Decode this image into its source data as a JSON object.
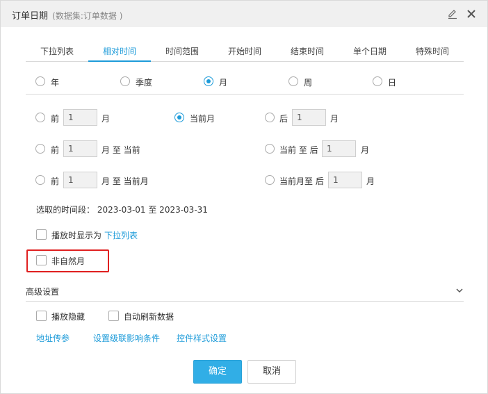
{
  "dialog": {
    "title": "订单日期",
    "dataset": "(数据集:订单数据 )",
    "icons": {
      "edit": "edit-pencil-icon",
      "close": "close-x-icon"
    }
  },
  "tabs": [
    {
      "label": "下拉列表",
      "active": false
    },
    {
      "label": "相对时间",
      "active": true
    },
    {
      "label": "时间范围",
      "active": false
    },
    {
      "label": "开始时间",
      "active": false
    },
    {
      "label": "结束时间",
      "active": false
    },
    {
      "label": "单个日期",
      "active": false
    },
    {
      "label": "特殊时间",
      "active": false
    }
  ],
  "units": [
    {
      "label": "年",
      "checked": false
    },
    {
      "label": "季度",
      "checked": false
    },
    {
      "label": "月",
      "checked": true
    },
    {
      "label": "周",
      "checked": false
    },
    {
      "label": "日",
      "checked": false
    }
  ],
  "options": {
    "row1": {
      "prev_label": "前",
      "prev_value": "1",
      "prev_unit": "月",
      "current_label": "当前月",
      "next_label": "后",
      "next_value": "1",
      "next_unit": "月"
    },
    "row2": {
      "prev_label": "前",
      "prev_value": "1",
      "prev_suffix": "月 至 当前",
      "curnext_label": "当前 至 后",
      "curnext_value": "1",
      "curnext_unit": "月"
    },
    "row3": {
      "prev_label": "前",
      "prev_value": "1",
      "prev_suffix": "月 至 当前月",
      "curnext_label": "当前月至 后",
      "curnext_value": "1",
      "curnext_unit": "月"
    }
  },
  "selected_range": "选取的时间段： 2023-03-01 至 2023-03-31",
  "display_as": {
    "label": "播放时显示为",
    "link": "下拉列表"
  },
  "non_natural_month": "非自然月",
  "advanced": {
    "title": "高级设置",
    "hide_on_play": "播放隐藏",
    "auto_refresh": "自动刷新数据",
    "links": [
      "地址传参",
      "设置级联影响条件",
      "控件样式设置"
    ]
  },
  "buttons": {
    "ok": "确定",
    "cancel": "取消"
  },
  "colors": {
    "accent": "#1d9bd9",
    "ok_button": "#31aee6",
    "highlight": "#e02020"
  }
}
